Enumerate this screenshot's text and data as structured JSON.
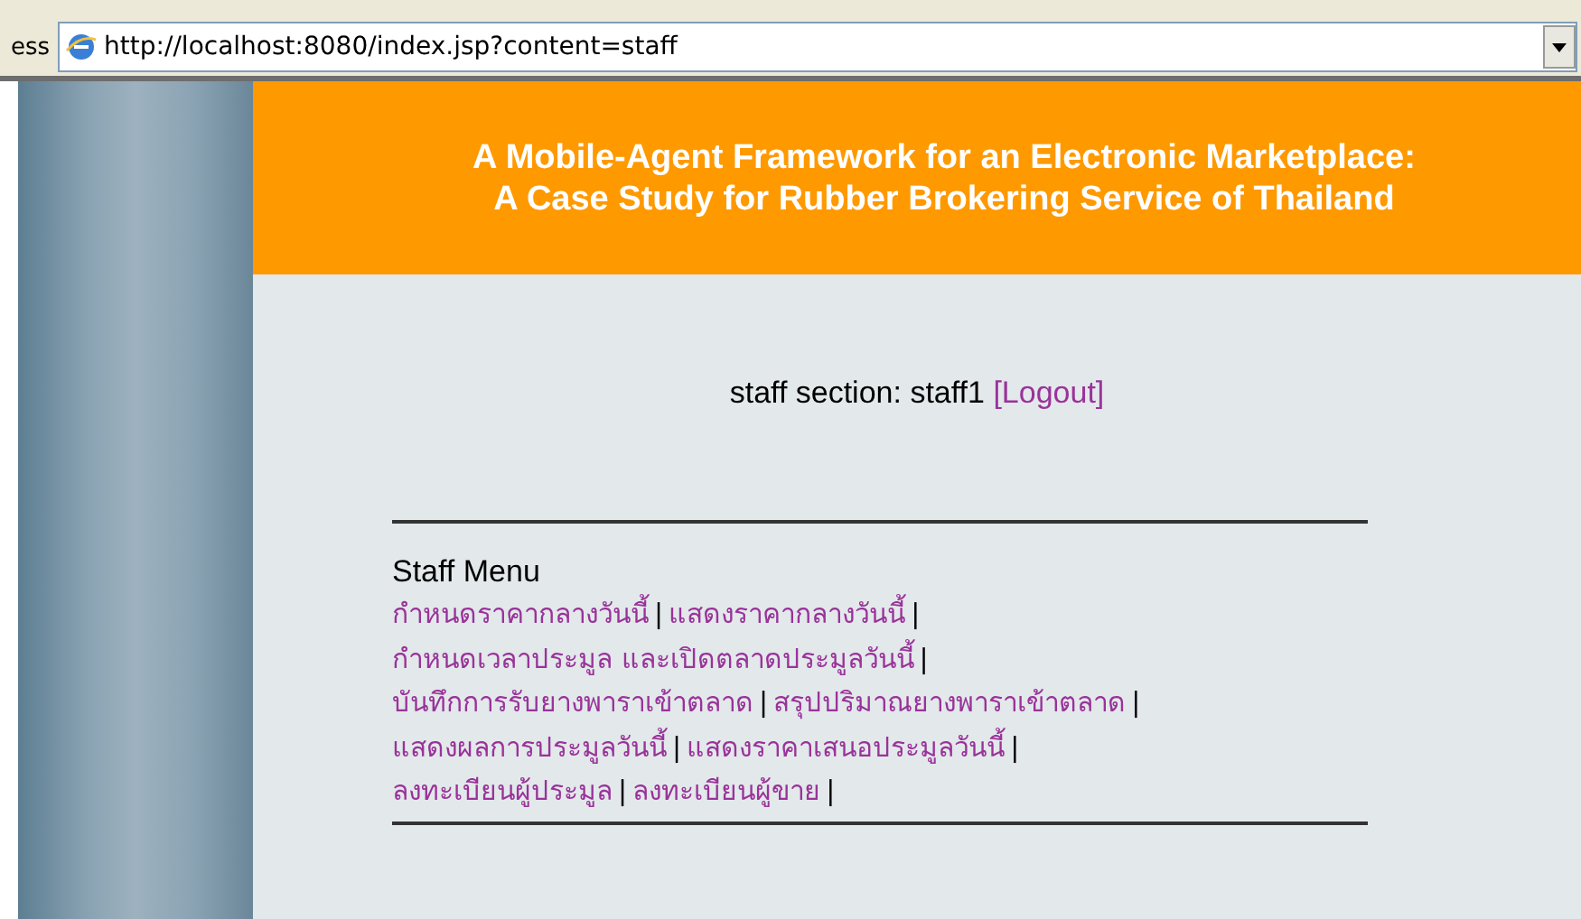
{
  "address_bar": {
    "label": "ess",
    "url": "http://localhost:8080/index.jsp?content=staff"
  },
  "header": {
    "title_lines": [
      "A Mobile-Agent Framework for an Electronic Marketplace:",
      "A Case Study for Rubber Brokering Service of Thailand"
    ]
  },
  "staff_section": {
    "text": "staff section: staff1",
    "logout_link": "[Logout]"
  },
  "staff_menu": {
    "title": "Staff Menu",
    "separator": "|",
    "rows": [
      [
        "กำหนดราคากลางวันนี้",
        "แสดงราคากลางวันนี้"
      ],
      [
        "กำหนดเวลาประมูล และเปิดตลาดประมูลวันนี้"
      ],
      [
        "บันทึกการรับยางพาราเข้าตลาด",
        "สรุปปริมาณยางพาราเข้าตลาด"
      ],
      [
        "แสดงผลการประมูลวันนี้",
        "แสดงราคาเสนอประมูลวันนี้"
      ],
      [
        "ลงทะเบียนผู้ประมูล",
        "ลงทะเบียนผู้ขาย"
      ]
    ]
  }
}
